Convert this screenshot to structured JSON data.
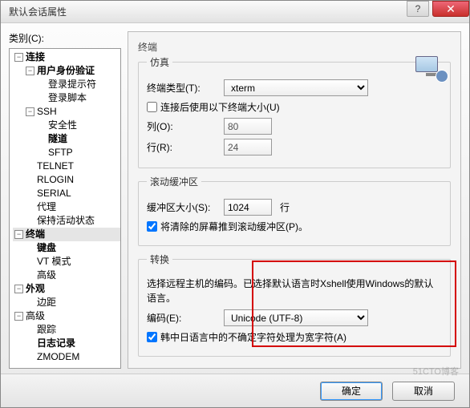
{
  "window": {
    "title": "默认会话属性"
  },
  "category_label": "类别(C):",
  "tree": {
    "connection": "连接",
    "auth": "用户身份验证",
    "login_prompt": "登录提示符",
    "login_script": "登录脚本",
    "ssh": "SSH",
    "security": "安全性",
    "tunnel": "隧道",
    "sftp": "SFTP",
    "telnet": "TELNET",
    "rlogin": "RLOGIN",
    "serial": "SERIAL",
    "proxy": "代理",
    "keepalive": "保持活动状态",
    "terminal": "终端",
    "keyboard": "键盘",
    "vtmode": "VT 模式",
    "advanced_t": "高级",
    "appearance": "外观",
    "margin": "边距",
    "advanced": "高级",
    "trace": "跟踪",
    "logging": "日志记录",
    "zmodem": "ZMODEM"
  },
  "main": {
    "heading": "终端",
    "emulation": {
      "legend": "仿真",
      "type_label": "终端类型(T):",
      "type_value": "xterm",
      "use_size_label": "连接后使用以下终端大小(U)",
      "cols_label": "列(O):",
      "cols_value": "80",
      "rows_label": "行(R):",
      "rows_value": "24"
    },
    "scrollback": {
      "legend": "滚动缓冲区",
      "size_label": "缓冲区大小(S):",
      "size_value": "1024",
      "unit": "行",
      "push_label": "将清除的屏幕推到滚动缓冲区(P)。"
    },
    "translation": {
      "legend": "转换",
      "desc": "选择远程主机的编码。已选择默认语言时Xshell使用Windows的默认语言。",
      "encoding_label": "编码(E):",
      "encoding_value": "Unicode (UTF-8)",
      "cjk_label": "韩中日语言中的不确定字符处理为宽字符(A)"
    }
  },
  "footer": {
    "ok": "确定",
    "cancel": "取消"
  },
  "watermark": "51CTO博客"
}
